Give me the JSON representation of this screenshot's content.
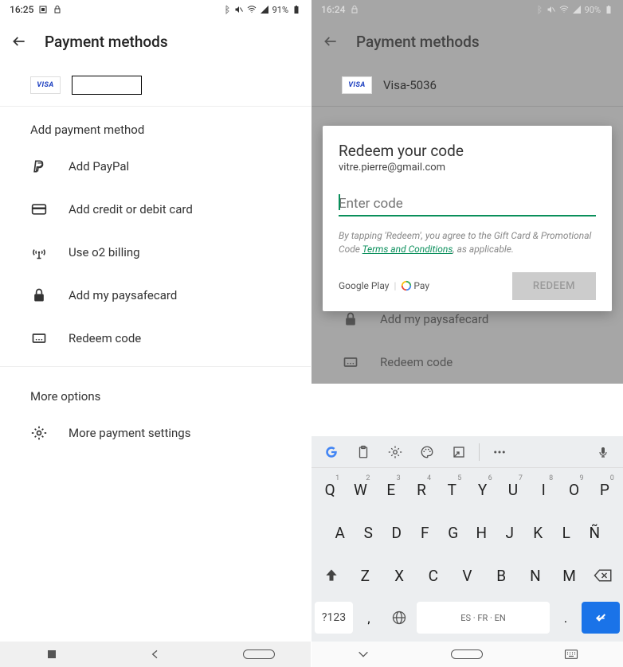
{
  "left": {
    "status": {
      "time": "16:25",
      "battery": "91%"
    },
    "header": {
      "title": "Payment methods"
    },
    "visa": {
      "badge": "VISA"
    },
    "add_heading": "Add payment method",
    "rows": {
      "paypal": "Add PayPal",
      "card": "Add credit or debit card",
      "o2": "Use o2 billing",
      "paysafe": "Add my paysafecard",
      "redeem": "Redeem code"
    },
    "more_heading": "More options",
    "more_settings": "More payment settings"
  },
  "right": {
    "status": {
      "time": "16:24",
      "battery": "90%"
    },
    "header": {
      "title": "Payment methods"
    },
    "visa": {
      "badge": "VISA",
      "label": "Visa-5036"
    },
    "rows": {
      "paysafe": "Add my paysafecard",
      "redeem": "Redeem code"
    },
    "dialog": {
      "title": "Redeem your code",
      "email": "vitre.pierre@gmail.com",
      "placeholder": "Enter code",
      "disclaimer_pre": "By tapping 'Redeem', you agree to the Gift Card & Promotional Code ",
      "disclaimer_link": "Terms and Conditions",
      "disclaimer_post": ", as applicable.",
      "play": "Google Play",
      "gpay": "Pay",
      "redeem_btn": "REDEEM"
    },
    "keyboard": {
      "row1": [
        "Q",
        "W",
        "E",
        "R",
        "T",
        "Y",
        "U",
        "I",
        "O",
        "P"
      ],
      "row1_sup": [
        "1",
        "2",
        "3",
        "4",
        "5",
        "6",
        "7",
        "8",
        "9",
        "0"
      ],
      "row2": [
        "A",
        "S",
        "D",
        "F",
        "G",
        "H",
        "J",
        "K",
        "L",
        "Ñ"
      ],
      "row3": [
        "Z",
        "X",
        "C",
        "V",
        "B",
        "N",
        "M"
      ],
      "sym": "?123",
      "space": "ES · FR · EN"
    }
  }
}
